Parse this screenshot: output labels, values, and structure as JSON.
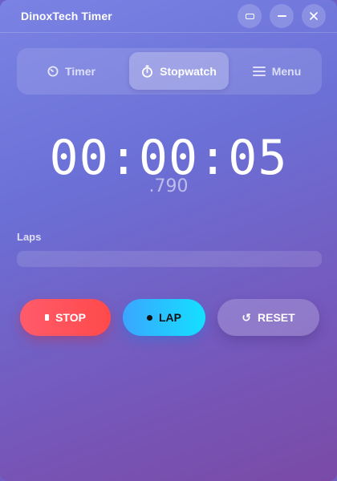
{
  "window": {
    "title": "DinoxTech Timer"
  },
  "tabs": [
    {
      "label": "Timer",
      "icon": "timer-icon"
    },
    {
      "label": "Stopwatch",
      "icon": "stopwatch-icon",
      "active": true
    },
    {
      "label": "Menu",
      "icon": "menu-icon"
    }
  ],
  "display": {
    "time": "00:00:05",
    "millis": ".790"
  },
  "laps": {
    "label": "Laps",
    "items": []
  },
  "actions": {
    "stop_label": "STOP",
    "lap_label": "LAP",
    "reset_label": "RESET",
    "reset_glyph": "↺"
  },
  "colors": {
    "stop": "#ff4f5e",
    "lap": "#1ec8ff",
    "background_top": "#7a83e4",
    "background_bottom": "#7a4aa6"
  }
}
